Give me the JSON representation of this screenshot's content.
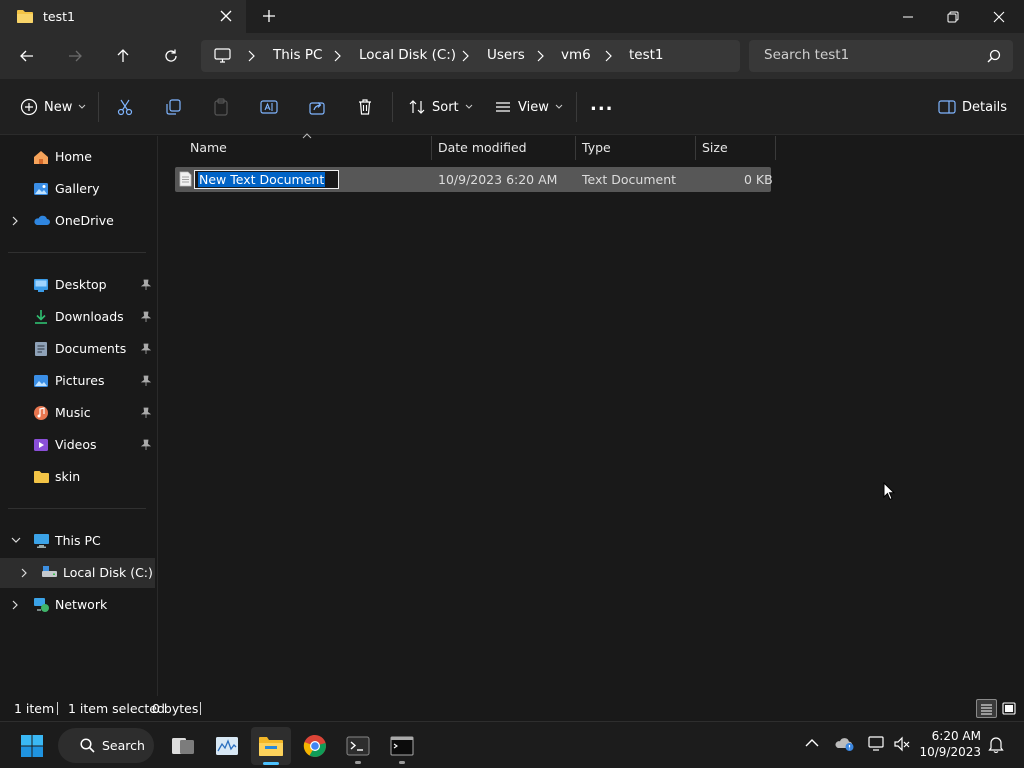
{
  "window": {
    "tab_title": "test1",
    "controls": [
      "minimize",
      "restore",
      "close"
    ]
  },
  "address": {
    "root_icon": "computer-icon",
    "breadcrumbs": [
      "This PC",
      "Local Disk (C:)",
      "Users",
      "vm6",
      "test1"
    ],
    "search_placeholder": "Search test1"
  },
  "toolbar": {
    "new_label": "New",
    "sort_label": "Sort",
    "view_label": "View",
    "details_label": "Details",
    "more_label": "..."
  },
  "sidebar": {
    "quick": [
      {
        "label": "Home",
        "icon": "home-icon"
      },
      {
        "label": "Gallery",
        "icon": "gallery-icon"
      },
      {
        "label": "OneDrive",
        "icon": "cloud-icon"
      }
    ],
    "pinned": [
      {
        "label": "Desktop",
        "icon": "desktop-folder-icon"
      },
      {
        "label": "Downloads",
        "icon": "downloads-folder-icon"
      },
      {
        "label": "Documents",
        "icon": "documents-folder-icon"
      },
      {
        "label": "Pictures",
        "icon": "pictures-folder-icon"
      },
      {
        "label": "Music",
        "icon": "music-folder-icon"
      },
      {
        "label": "Videos",
        "icon": "videos-folder-icon"
      },
      {
        "label": "skin",
        "icon": "folder-icon"
      }
    ],
    "drives": [
      {
        "label": "This PC",
        "icon": "monitor-icon"
      },
      {
        "label": "Local Disk (C:)",
        "icon": "drive-icon"
      },
      {
        "label": "Network",
        "icon": "network-icon"
      }
    ]
  },
  "columns": {
    "name": "Name",
    "date": "Date modified",
    "type": "Type",
    "size": "Size"
  },
  "files": [
    {
      "name": "New Text Document",
      "date": "10/9/2023 6:20 AM",
      "type": "Text Document",
      "size": "0 KB",
      "renaming": true
    }
  ],
  "status": {
    "count": "1 item",
    "selected": "1 item selected",
    "bytes": "0 bytes"
  },
  "taskbar": {
    "search_label": "Search",
    "time": "6:20 AM",
    "date": "10/9/2023"
  },
  "colors": {
    "accent": "#0063c6",
    "folder": "#f3c446",
    "selection_row": "#575757"
  }
}
